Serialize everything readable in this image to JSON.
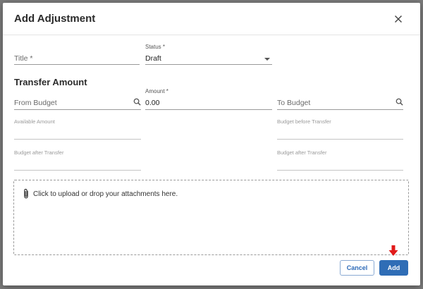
{
  "dialog": {
    "title": "Add Adjustment",
    "close_icon": "close-icon"
  },
  "form": {
    "title_placeholder": "Title *",
    "status": {
      "label": "Status *",
      "value": "Draft"
    },
    "transfer_section_title": "Transfer Amount",
    "from_budget_placeholder": "From Budget",
    "amount": {
      "label": "Amount *",
      "value": "0.00"
    },
    "to_budget_placeholder": "To Budget",
    "available_amount_label": "Available Amount",
    "budget_before_transfer_label": "Budget before Transfer",
    "budget_after_transfer_left_label": "Budget after Transfer",
    "budget_after_transfer_right_label": "Budget after Transfer"
  },
  "upload": {
    "text": "Click to upload or drop your attachments here.",
    "icon": "paperclip-icon"
  },
  "actions": {
    "cancel_label": "Cancel",
    "add_label": "Add"
  },
  "colors": {
    "primary": "#2f6db6",
    "annotation_arrow": "#e11a1a"
  }
}
